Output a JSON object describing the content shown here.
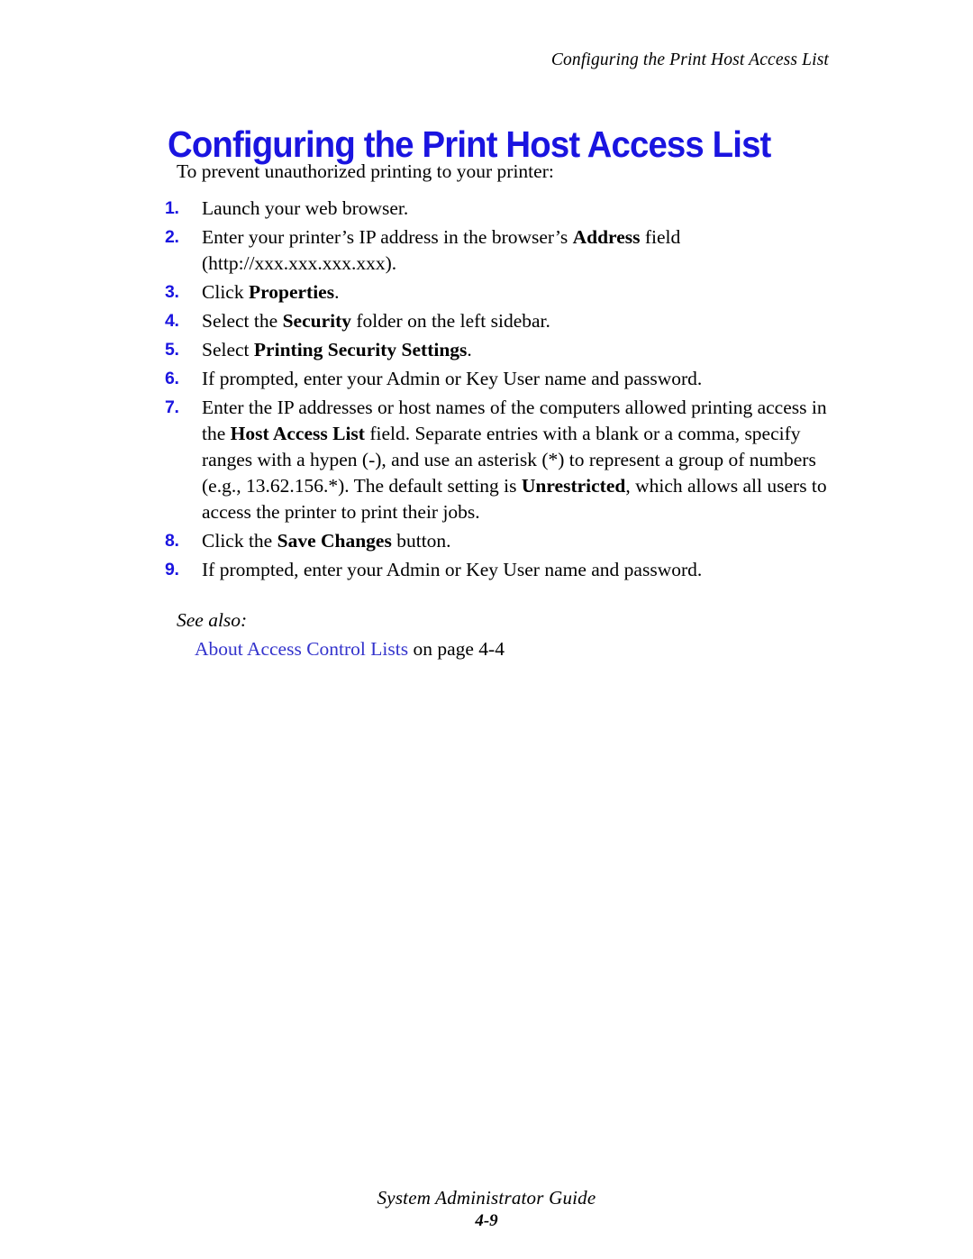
{
  "header": {
    "running_title": "Configuring the Print Host Access List"
  },
  "title": "Configuring the Print Host Access List",
  "body": {
    "intro": "To prevent unauthorized printing to your printer:",
    "steps": [
      {
        "number": "1.",
        "html": "Launch your web browser."
      },
      {
        "number": "2.",
        "html": "Enter your printer’s IP address in the browser’s <b>Address</b> field (http://xxx.xxx.xxx.xxx)."
      },
      {
        "number": "3.",
        "html": "Click <b>Properties</b>."
      },
      {
        "number": "4.",
        "html": "Select the <b>Security</b> folder on the left sidebar."
      },
      {
        "number": "5.",
        "html": "Select <b>Printing Security Settings</b>."
      },
      {
        "number": "6.",
        "html": "If prompted, enter your Admin or Key User name and password."
      },
      {
        "number": "7.",
        "html": "Enter the IP addresses or host names of the computers allowed printing access in the <b>Host Access List</b> field. Separate entries with a blank or a comma, specify ranges with a hypen (-), and use an asterisk (*) to represent a group of numbers (e.g., 13.62.156.*). The default setting is <b>Unrestricted</b>, which allows all users to access the printer to print their jobs."
      },
      {
        "number": "8.",
        "html": "Click the <b>Save Changes</b> button."
      },
      {
        "number": "9.",
        "html": "If prompted, enter your Admin or Key User name and password."
      }
    ]
  },
  "see_also": {
    "label": "See also:",
    "link_text": "About Access Control Lists",
    "suffix": " on page 4-4"
  },
  "footer": {
    "guide_title": "System Administrator Guide",
    "page_number": "4-9"
  },
  "colors": {
    "title_blue": "#1a14e0",
    "number_blue": "#1a14e0",
    "link_blue": "#3333cc",
    "body_text": "#000000",
    "page_background": "#ffffff"
  }
}
